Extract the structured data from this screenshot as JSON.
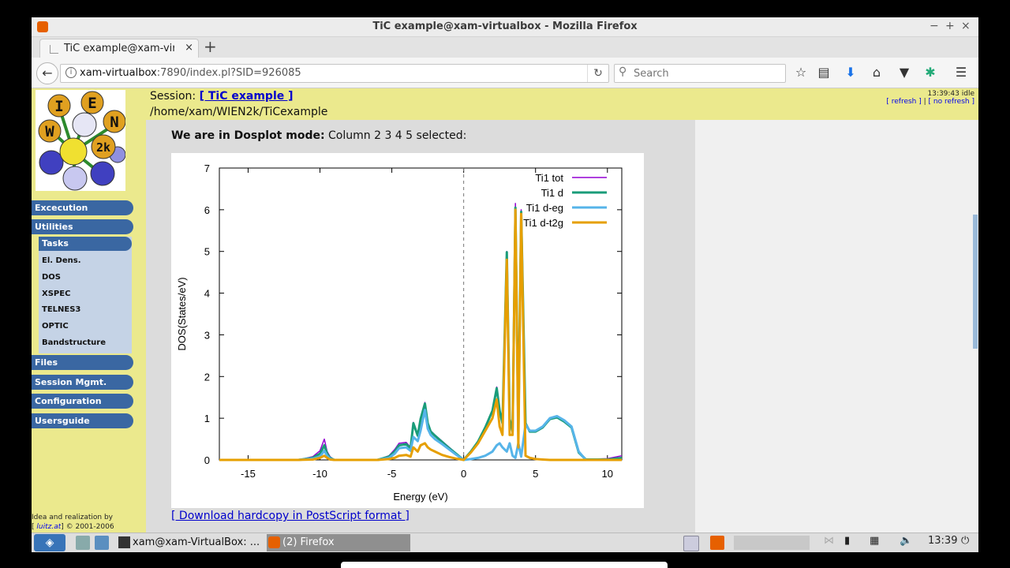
{
  "window": {
    "title": "TiC example@xam-virtualbox - Mozilla Firefox",
    "minimize": "−",
    "maximize": "+",
    "close": "×"
  },
  "tab": {
    "title": "TiC example@xam-virtualbox",
    "close": "×",
    "new_tab": "+"
  },
  "url": {
    "host": "xam-virtualbox",
    "rest": ":7890/index.pl?SID=926085"
  },
  "search": {
    "placeholder": "Search"
  },
  "session": {
    "label": "Session:",
    "link": "[ TiC example ]",
    "path": "/home/xam/WIEN2k/TiCexample"
  },
  "clock": {
    "status": "13:39:43 idle",
    "refresh": "[ refresh ]",
    "sep": " | ",
    "no_refresh": "[ no refresh ]"
  },
  "sidebar": {
    "items": [
      "Excecution",
      "Utilities",
      "Files",
      "Session Mgmt.",
      "Configuration",
      "Usersguide"
    ],
    "tasks_label": "Tasks",
    "subitems": [
      "El. Dens.",
      "DOS",
      "XSPEC",
      "TELNES3",
      "OPTIC",
      "Bandstructure"
    ],
    "credits_line1": "Idea and realization by",
    "credits_link": "luitz.at",
    "credits_line2": "] © 2001-2006",
    "credits_bracket": "[ "
  },
  "logo": {
    "letters": [
      "I",
      "E",
      "N",
      "W",
      "2k"
    ]
  },
  "mode": {
    "bold": "We are in Dosplot mode:",
    "rest": " Column 2 3 4 5 selected:"
  },
  "download": "[ Download hardcopy in PostScript format ]",
  "chart_data": {
    "type": "line",
    "xlabel": "Energy (eV)",
    "ylabel": "DOS(States/eV)",
    "xlim": [
      -17,
      11
    ],
    "ylim": [
      0,
      7
    ],
    "xticks": [
      -15,
      -10,
      -5,
      0,
      5,
      10
    ],
    "yticks": [
      0,
      1,
      2,
      3,
      4,
      5,
      6,
      7
    ],
    "fermi_line": 0,
    "legend_position": "top-right",
    "series": [
      {
        "name": "Ti1 tot",
        "color": "#9400d3",
        "x": [
          -17,
          -11.5,
          -10.5,
          -10,
          -9.7,
          -9.5,
          -9.3,
          -9,
          -6,
          -5.2,
          -4.8,
          -4.5,
          -4,
          -3.7,
          -3.5,
          -3.2,
          -3,
          -2.7,
          -2.5,
          -2.3,
          -2,
          -1.5,
          -1,
          -0.5,
          0,
          0.5,
          1,
          1.5,
          2,
          2.3,
          2.5,
          2.7,
          3,
          3.2,
          3.4,
          3.6,
          3.8,
          4,
          4.3,
          4.6,
          5,
          5.5,
          6,
          6.5,
          7,
          7.5,
          8,
          8.5,
          9,
          10,
          11
        ],
        "y": [
          0,
          0,
          0.08,
          0.22,
          0.5,
          0.2,
          0.08,
          0,
          0,
          0.1,
          0.25,
          0.4,
          0.42,
          0.3,
          0.9,
          0.6,
          1.0,
          1.38,
          0.9,
          0.7,
          0.6,
          0.45,
          0.3,
          0.15,
          0,
          0.2,
          0.45,
          0.8,
          1.2,
          1.75,
          1.2,
          0.9,
          5.0,
          1.0,
          0.7,
          6.15,
          0.7,
          6.0,
          0.9,
          0.7,
          0.7,
          0.8,
          1.0,
          1.05,
          0.95,
          0.8,
          0.2,
          0.02,
          0.02,
          0.03,
          0.1
        ]
      },
      {
        "name": "Ti1 d",
        "color": "#1a9c7a",
        "x": [
          -17,
          -11.5,
          -10.5,
          -10,
          -9.7,
          -9.5,
          -9.3,
          -9,
          -6,
          -5.2,
          -4.8,
          -4.5,
          -4,
          -3.7,
          -3.5,
          -3.2,
          -3,
          -2.7,
          -2.5,
          -2.3,
          -2,
          -1.5,
          -1,
          -0.5,
          0,
          0.5,
          1,
          1.5,
          2,
          2.3,
          2.5,
          2.7,
          3,
          3.2,
          3.4,
          3.6,
          3.8,
          4,
          4.3,
          4.6,
          5,
          5.5,
          6,
          6.5,
          7,
          7.5,
          8,
          8.5,
          9,
          10,
          11
        ],
        "y": [
          0,
          0,
          0.05,
          0.15,
          0.35,
          0.15,
          0.05,
          0,
          0,
          0.08,
          0.2,
          0.35,
          0.38,
          0.28,
          0.88,
          0.58,
          0.98,
          1.35,
          0.88,
          0.68,
          0.58,
          0.43,
          0.28,
          0.14,
          0,
          0.2,
          0.44,
          0.78,
          1.18,
          1.72,
          1.18,
          0.88,
          4.98,
          0.98,
          0.68,
          6.05,
          0.68,
          5.95,
          0.88,
          0.68,
          0.68,
          0.78,
          0.98,
          1.02,
          0.92,
          0.78,
          0.18,
          0.01,
          0.01,
          0.01,
          0.05
        ]
      },
      {
        "name": "Ti1 d-eg",
        "color": "#56b4e9",
        "x": [
          -17,
          -11.5,
          -10.5,
          -10,
          -9.7,
          -9.5,
          -9.3,
          -9,
          -6,
          -5.2,
          -4.8,
          -4.5,
          -4,
          -3.7,
          -3.5,
          -3.2,
          -3,
          -2.7,
          -2.5,
          -2.3,
          -2,
          -1.5,
          -1,
          -0.5,
          0,
          0.5,
          1,
          1.5,
          2,
          2.3,
          2.5,
          2.7,
          3,
          3.2,
          3.4,
          3.6,
          3.8,
          4,
          4.3,
          4.6,
          5,
          5.5,
          6,
          6.5,
          7,
          7.5,
          8,
          8.5,
          9,
          10,
          11
        ],
        "y": [
          0,
          0,
          0.03,
          0.08,
          0.22,
          0.1,
          0.03,
          0,
          0,
          0.05,
          0.15,
          0.28,
          0.3,
          0.22,
          0.55,
          0.45,
          0.7,
          1.2,
          0.75,
          0.6,
          0.5,
          0.38,
          0.25,
          0.12,
          0,
          0.02,
          0.05,
          0.1,
          0.2,
          0.35,
          0.4,
          0.3,
          0.2,
          0.4,
          0.1,
          0.05,
          0.4,
          0.08,
          0.85,
          0.7,
          0.7,
          0.8,
          1.0,
          1.05,
          0.95,
          0.8,
          0.2,
          0,
          0,
          0,
          0
        ]
      },
      {
        "name": "Ti1 d-t2g",
        "color": "#e69f00",
        "x": [
          -17,
          -11.5,
          -10.5,
          -10,
          -9.7,
          -9.5,
          -9.3,
          -9,
          -6,
          -5.2,
          -4.8,
          -4.5,
          -4,
          -3.7,
          -3.5,
          -3.2,
          -3,
          -2.7,
          -2.5,
          -2.3,
          -2,
          -1.5,
          -1,
          -0.5,
          0,
          0.5,
          1,
          1.5,
          2,
          2.3,
          2.5,
          2.7,
          3,
          3.2,
          3.4,
          3.6,
          3.8,
          4,
          4.3,
          4.6,
          5,
          5.5,
          6,
          6.5,
          7,
          7.5,
          8,
          8.5,
          9,
          10,
          11
        ],
        "y": [
          0,
          0,
          0.01,
          0.05,
          0.1,
          0.05,
          0.01,
          0,
          0,
          0.02,
          0.05,
          0.1,
          0.12,
          0.08,
          0.3,
          0.2,
          0.35,
          0.4,
          0.3,
          0.25,
          0.2,
          0.12,
          0.07,
          0.03,
          0,
          0.18,
          0.4,
          0.7,
          1.0,
          1.45,
          0.8,
          0.6,
          4.8,
          0.6,
          0.6,
          6.0,
          0.3,
          5.9,
          0.1,
          0.05,
          0.02,
          0.01,
          0,
          0,
          0,
          0,
          0,
          0,
          0,
          0,
          0
        ]
      }
    ]
  },
  "taskbar": {
    "task1": "xam@xam-VirtualBox: ...",
    "task2": "(2) Firefox",
    "time": "13:39"
  }
}
